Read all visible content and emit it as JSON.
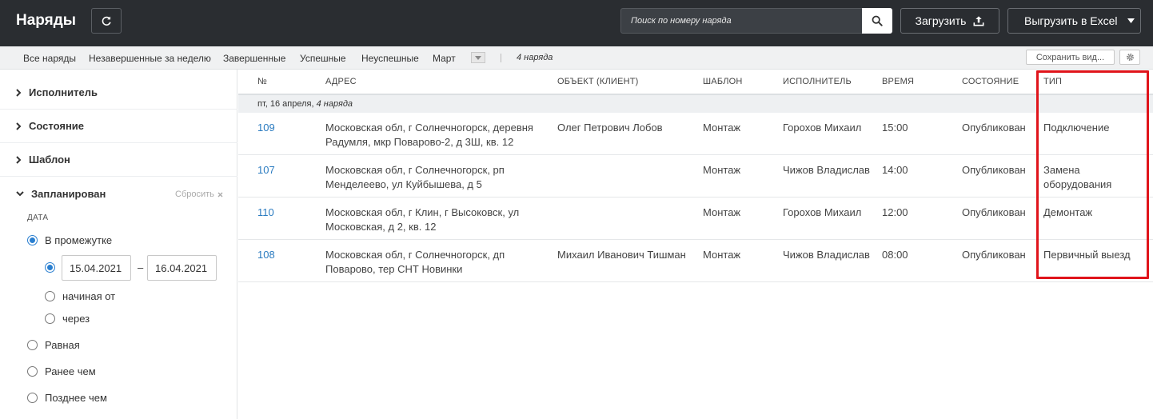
{
  "header": {
    "title": "Наряды",
    "search_placeholder": "Поиск по номеру наряда",
    "upload_label": "Загрузить",
    "export_label": "Выгрузить в Excel"
  },
  "filters": {
    "tabs": [
      "Все наряды",
      "Незавершенные за неделю",
      "Завершенные",
      "Успешные",
      "Неуспешные",
      "Март"
    ],
    "count": "4 наряда",
    "save_view_label": "Сохранить вид..."
  },
  "sidebar": {
    "sections": [
      "Исполнитель",
      "Состояние",
      "Шаблон",
      "Запланирован"
    ],
    "reset_label": "Сбросить",
    "date_label": "ДАТА",
    "options": {
      "range": "В промежутке",
      "starting_from": "начиная от",
      "through": "через",
      "equal": "Равная",
      "before": "Ранее чем",
      "after": "Позднее чем"
    },
    "date_from": "15.04.2021",
    "date_dash": "–",
    "date_to": "16.04.2021"
  },
  "table": {
    "columns": [
      "№",
      "АДРЕС",
      "ОБЪЕКТ (КЛИЕНТ)",
      "ШАБЛОН",
      "ИСПОЛНИТЕЛЬ",
      "ВРЕМЯ",
      "СОСТОЯНИЕ",
      "ТИП"
    ],
    "group_date": "пт, 16 апреля,",
    "group_count": "4 наряда",
    "rows": [
      {
        "num": "109",
        "address": "Московская обл, г Солнечногорск, деревня Радумля, мкр Поварово-2, д 3Ш, кв. 12",
        "client": "Олег Петрович Лобов",
        "template": "Монтаж",
        "executor": "Горохов Михаил",
        "time": "15:00",
        "status": "Опубликован",
        "type": "Подключение"
      },
      {
        "num": "107",
        "address": "Московская обл, г Солнечногорск, рп Менделеево, ул Куйбышева, д 5",
        "client": "",
        "template": "Монтаж",
        "executor": "Чижов Владислав",
        "time": "14:00",
        "status": "Опубликован",
        "type": "Замена оборудования"
      },
      {
        "num": "110",
        "address": "Московская обл, г Клин, г Высоковск, ул Московская, д 2, кв. 12",
        "client": "",
        "template": "Монтаж",
        "executor": "Горохов Михаил",
        "time": "12:00",
        "status": "Опубликован",
        "type": "Демонтаж"
      },
      {
        "num": "108",
        "address": "Московская обл, г Солнечногорск, дп Поварово, тер СНТ Новинки",
        "client": "Михаил Иванович Тишман",
        "template": "Монтаж",
        "executor": "Чижов Владислав",
        "time": "08:00",
        "status": "Опубликован",
        "type": "Первичный выезд"
      }
    ]
  },
  "colors": {
    "topbar": "#2a2d31",
    "accent": "#2a7fd0",
    "link": "#2a7bc0",
    "highlight": "#e0141b"
  },
  "icons": [
    "refresh-icon",
    "search-icon",
    "upload-icon",
    "caret-down-icon",
    "gear-icon",
    "chevron-right-icon",
    "chevron-down-icon",
    "close-small-icon"
  ]
}
